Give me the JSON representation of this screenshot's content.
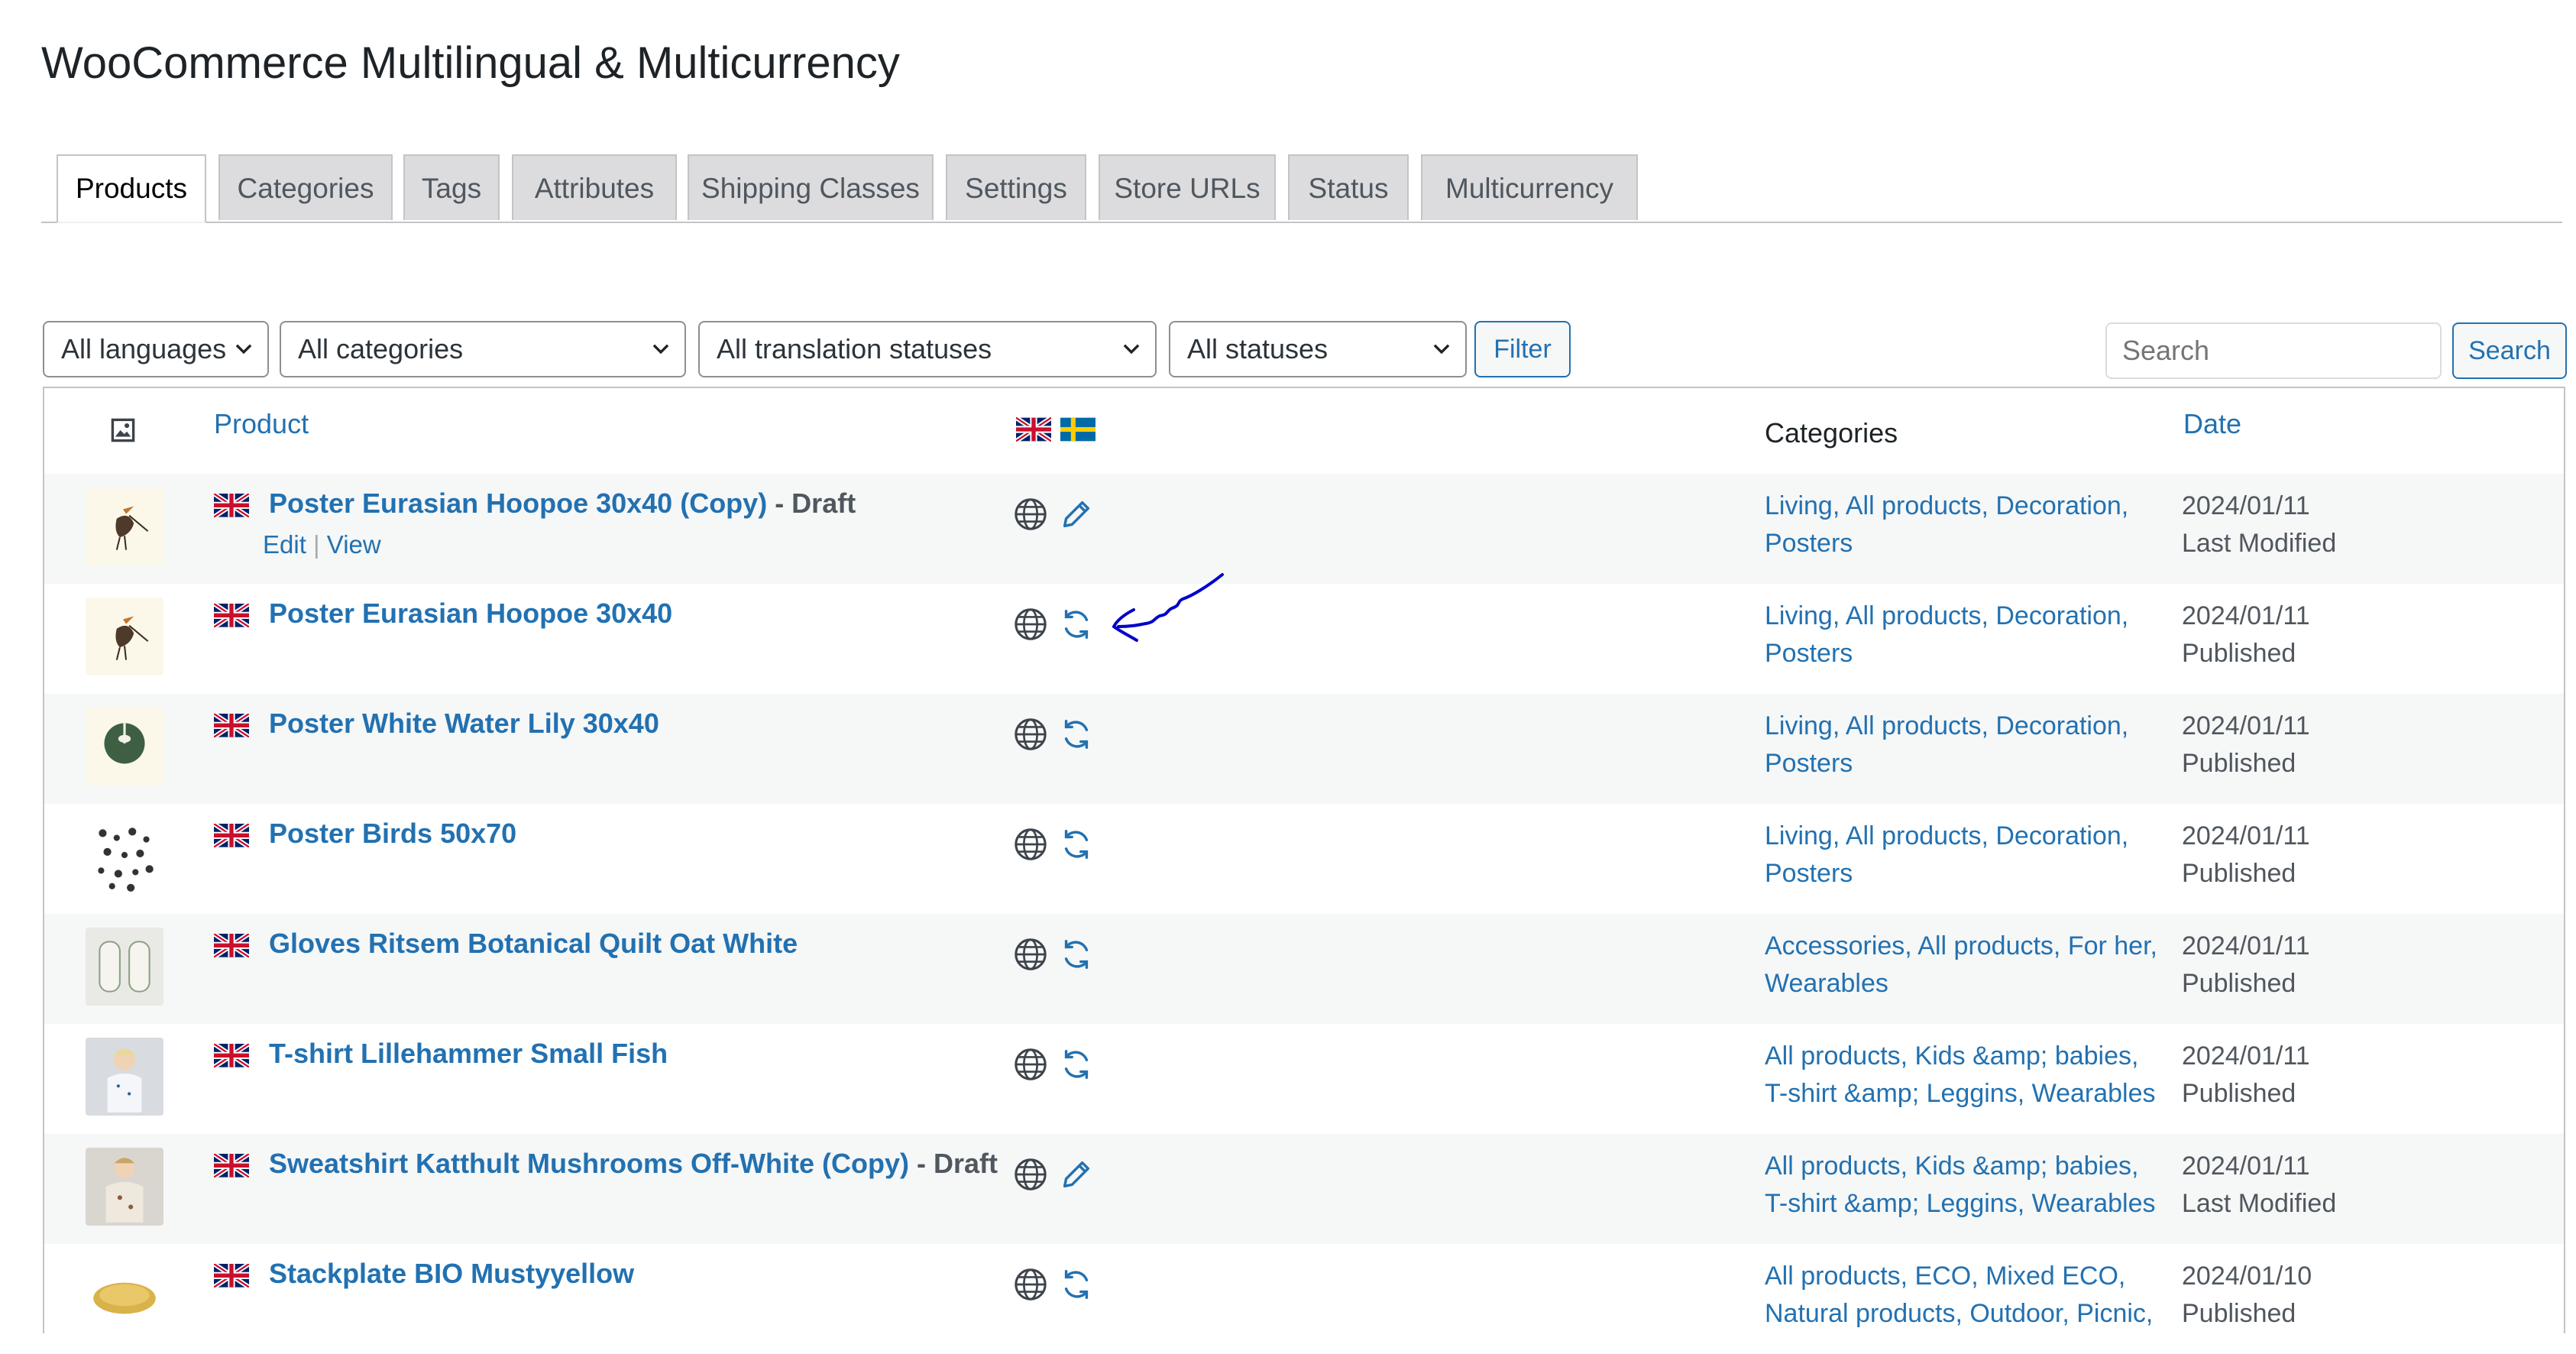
{
  "page_title": "WooCommerce Multilingual & Multicurrency",
  "tabs": [
    {
      "label": "Products",
      "active": true
    },
    {
      "label": "Categories"
    },
    {
      "label": "Tags"
    },
    {
      "label": "Attributes"
    },
    {
      "label": "Shipping Classes"
    },
    {
      "label": "Settings"
    },
    {
      "label": "Store URLs"
    },
    {
      "label": "Status"
    },
    {
      "label": "Multicurrency"
    }
  ],
  "filters": {
    "languages": "All languages",
    "categories": "All categories",
    "translation_statuses": "All translation statuses",
    "statuses": "All statuses",
    "filter_button": "Filter",
    "search_placeholder": "Search",
    "search_button": "Search"
  },
  "table": {
    "headers": {
      "image": "image-icon",
      "product": "Product",
      "categories": "Categories",
      "date": "Date"
    },
    "rows": [
      {
        "name": "Poster Eurasian Hoopoe 30x40 (Copy)",
        "suffix": " - Draft",
        "actions": {
          "edit": "Edit",
          "sep": "|",
          "view": "View"
        },
        "status_icon": "pencil-icon",
        "cat1": "Living, All products, Decoration,",
        "cat2": "Posters",
        "date": "2024/01/11",
        "state": "Last Modified",
        "thumb": "hoopoe"
      },
      {
        "name": "Poster Eurasian Hoopoe 30x40",
        "suffix": "",
        "status_icon": "refresh-icon",
        "cat1": "Living, All products, Decoration,",
        "cat2": "Posters",
        "date": "2024/01/11",
        "state": "Published",
        "thumb": "hoopoe"
      },
      {
        "name": "Poster White Water Lily 30x40",
        "suffix": "",
        "status_icon": "refresh-icon",
        "cat1": "Living, All products, Decoration,",
        "cat2": "Posters",
        "date": "2024/01/11",
        "state": "Published",
        "thumb": "lily"
      },
      {
        "name": "Poster Birds 50x70",
        "suffix": "",
        "status_icon": "refresh-icon",
        "cat1": "Living, All products, Decoration,",
        "cat2": "Posters",
        "date": "2024/01/11",
        "state": "Published",
        "thumb": "birds"
      },
      {
        "name": "Gloves Ritsem Botanical Quilt Oat White",
        "suffix": "",
        "status_icon": "refresh-icon",
        "cat1": "Accessories, All products, For her,",
        "cat2": "Wearables",
        "date": "2024/01/11",
        "state": "Published",
        "thumb": "gloves"
      },
      {
        "name": "T-shirt Lillehammer Small Fish",
        "suffix": "",
        "status_icon": "refresh-icon",
        "cat1": "All products, Kids &amp; babies,",
        "cat2": "T-shirt &amp; Leggins, Wearables",
        "date": "2024/01/11",
        "state": "Published",
        "thumb": "kid"
      },
      {
        "name": "Sweatshirt Katthult Mushrooms Off-White (Copy)",
        "suffix": " - Draft",
        "status_icon": "pencil-icon",
        "cat1": "All products, Kids &amp; babies,",
        "cat2": "T-shirt &amp; Leggins, Wearables",
        "date": "2024/01/11",
        "state": "Last Modified",
        "thumb": "kid2"
      },
      {
        "name": "Stackplate BIO Mustyyellow",
        "suffix": "",
        "status_icon": "refresh-icon",
        "cat1": "All products, ECO, Mixed ECO,",
        "cat2": "Natural products, Outdoor, Picnic,",
        "date": "2024/01/10",
        "state": "Published",
        "thumb": "plate"
      }
    ]
  },
  "colors": {
    "link": "#2271b1",
    "text": "#1d2327",
    "muted": "#50575e",
    "border": "#c3c4c7",
    "alt_row": "#f6f7f7",
    "annotation": "#0000cc"
  }
}
